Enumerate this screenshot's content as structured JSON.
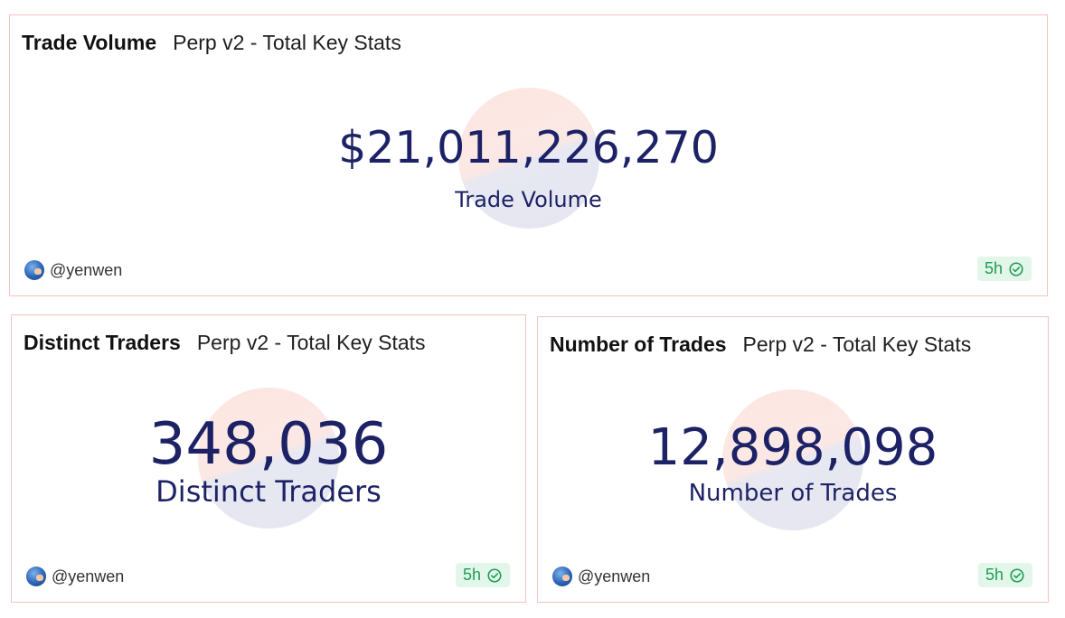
{
  "cards": [
    {
      "title": "Trade Volume",
      "subtitle": "Perp v2 - Total Key Stats",
      "value": "$21,011,226,270",
      "label": "Trade Volume",
      "author": "@yenwen",
      "freshness": "5h"
    },
    {
      "title": "Distinct Traders",
      "subtitle": "Perp v2 - Total Key Stats",
      "value": "348,036",
      "label": "Distinct Traders",
      "author": "@yenwen",
      "freshness": "5h"
    },
    {
      "title": "Number of Trades",
      "subtitle": "Perp v2 - Total Key Stats",
      "value": "12,898,098",
      "label": "Number of Trades",
      "author": "@yenwen",
      "freshness": "5h"
    }
  ],
  "colors": {
    "border": "#f3c3bc",
    "value_text": "#1d2266",
    "fresh_bg": "#e3f6ea",
    "fresh_text": "#1f9d55"
  },
  "icons": {
    "avatar": "user-avatar",
    "freshness": "check-circle-icon"
  }
}
